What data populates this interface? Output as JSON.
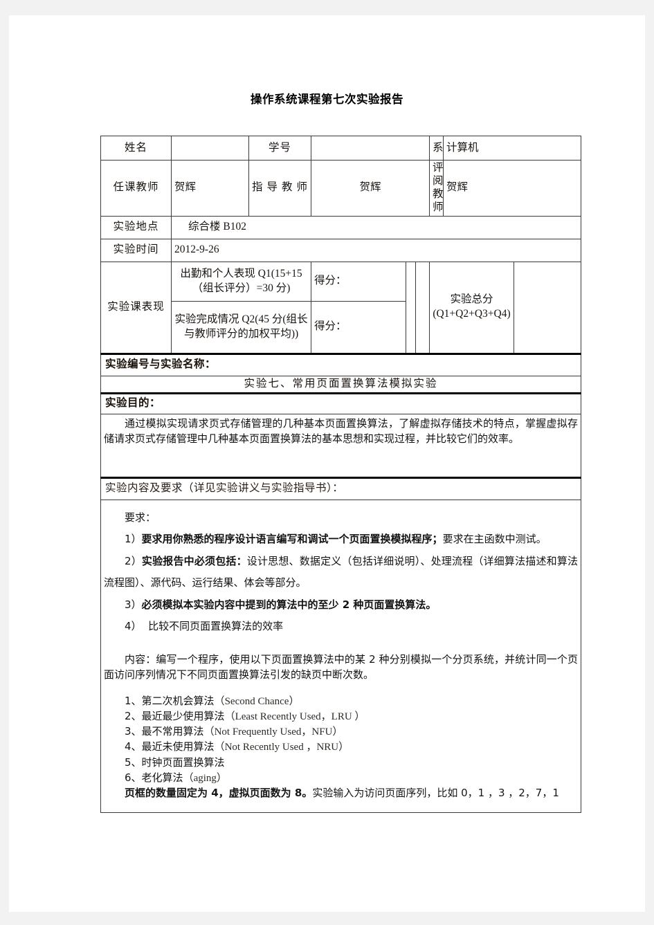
{
  "document": {
    "title": "操作系统课程第七次实验报告"
  },
  "info_table": {
    "row_name": {
      "label_name": "姓名",
      "value_name": "",
      "label_id": "学号",
      "value_id": "",
      "label_dept": "系",
      "value_dept": "计算机"
    },
    "row_teacher": {
      "label_course_teacher": "任课教师",
      "value_course_teacher": "贺辉",
      "label_guide_teacher": "指 导 教 师",
      "value_guide_teacher": "贺辉",
      "label_review_teacher": "评阅教师",
      "value_review_teacher": "贺辉"
    },
    "row_place": {
      "label": "实验地点",
      "value": "综合楼 B102"
    },
    "row_time": {
      "label": "实验时间",
      "value": "2012-9-26"
    },
    "row_performance": {
      "label": "实验课表现",
      "item1_text": "出勤和个人表现 Q1(15+15（组长评分）=30 分)",
      "item1_score_label": "得分：",
      "item1_score_value": "",
      "item2_text": "实验完成情况 Q2(45 分(组长与教师评分的加权平均))",
      "item2_score_label": "得分：",
      "item2_score_value": "",
      "total_label": "实验总分(Q1+Q2+Q3+Q4)",
      "total_value": ""
    }
  },
  "sections": {
    "exp_number_name_header": "实验编号与实验名称：",
    "exp_title": "实验七、常用页面置换算法模拟实验",
    "purpose_header": "实验目的：",
    "purpose_text": "通过模拟实现请求页式存储管理的几种基本页面置换算法，了解虚拟存储技术的特点，掌握虚拟存储请求页式存储管理中几种基本页面置换算法的基本思想和实现过程，并比较它们的效率。",
    "content_header": "实验内容及要求（详见实验讲义与实验指导书）：",
    "requirements_label": "要求：",
    "req1_num": "1）",
    "req1_bold": "要求用你熟悉的程序设计语言编写和调试一个页面置换模拟程序；",
    "req1_rest": "要求在主函数中测试。",
    "req2_num": "2）",
    "req2_bold": "实验报告中必须包括：",
    "req2_rest": "设计思想、数据定义（包括详细说明）、处理流程（详细算法描述和算法流程图）、源代码、运行结果、体会等部分。",
    "req3_num": "3）",
    "req3_bold": "必须模拟本实验内容中提到的算法中的至少 2 种页面置换算法。",
    "req4_num": "4）",
    "req4_text": "比较不同页面置换算法的效率",
    "content_label": "内容：",
    "content_text": "编写一个程序，使用以下页面置换算法中的某 2 种分别模拟一个分页系统，并统计同一个页面访问序列情况下不同页面置换算法引发的缺页中断次数。",
    "algorithms": [
      {
        "num": "1、",
        "cn": "第二次机会算法",
        "en": "（Second Chance）"
      },
      {
        "num": "2、",
        "cn": "最近最少使用算法",
        "en": "（Least Recently Used，LRU  ）"
      },
      {
        "num": "3、",
        "cn": "最不常用算法",
        "en": "（Not Frequently Used，NFU）"
      },
      {
        "num": "4、",
        "cn": "最近未使用算法",
        "en": "（Not  Recently Used ，NRU）"
      },
      {
        "num": "5、",
        "cn": "时钟页面置换算法",
        "en": ""
      },
      {
        "num": "6、",
        "cn": "老化算法",
        "en": "（aging）"
      }
    ],
    "tail_bold": "页框的数量固定为 4，虚拟页面数为 8。",
    "tail_rest": "实验输入为访问页面序列，比如 0，1 ，3 ，2，7，1"
  }
}
